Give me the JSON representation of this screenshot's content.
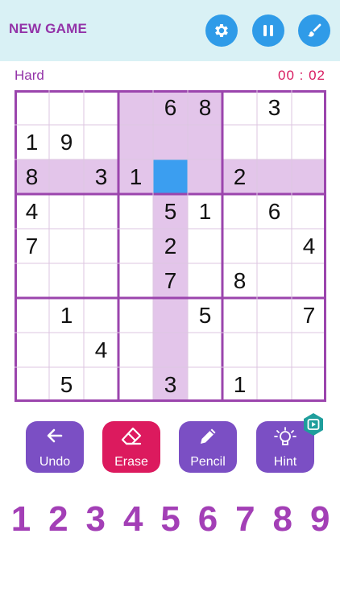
{
  "header": {
    "new_game_label": "NEW GAME",
    "buttons": [
      {
        "name": "settings",
        "icon": "gear-icon"
      },
      {
        "name": "pause",
        "icon": "pause-icon"
      },
      {
        "name": "theme",
        "icon": "paint-brush-icon"
      }
    ]
  },
  "status": {
    "difficulty": "Hard",
    "timer": "00 : 02"
  },
  "board": {
    "rows": [
      [
        "",
        "",
        "",
        "",
        "6",
        "8",
        "",
        "3",
        ""
      ],
      [
        "1",
        "9",
        "",
        "",
        "",
        "",
        "",
        "",
        ""
      ],
      [
        "8",
        "",
        "3",
        "1",
        "",
        "",
        "2",
        "",
        ""
      ],
      [
        "4",
        "",
        "",
        "",
        "5",
        "1",
        "",
        "6",
        ""
      ],
      [
        "7",
        "",
        "",
        "",
        "2",
        "",
        "",
        "",
        "4"
      ],
      [
        "",
        "",
        "",
        "",
        "7",
        "",
        "8",
        "",
        ""
      ],
      [
        "",
        "1",
        "",
        "",
        "",
        "5",
        "",
        "",
        "7"
      ],
      [
        "",
        "",
        "4",
        "",
        "",
        "",
        "",
        "",
        ""
      ],
      [
        "",
        "5",
        "",
        "",
        "3",
        "",
        "1",
        "",
        ""
      ]
    ],
    "selected": {
      "row": 2,
      "col": 4
    },
    "colors": {
      "highlight": "#e3c5ea",
      "selected": "#3b9ef0",
      "thin_line": "#dcc6e1",
      "thick_line": "#9b45ad"
    }
  },
  "actions": [
    {
      "name": "undo",
      "label": "Undo",
      "icon": "arrow-left-icon",
      "color": "#7b4fc4"
    },
    {
      "name": "erase",
      "label": "Erase",
      "icon": "eraser-icon",
      "color": "#dc1a5e"
    },
    {
      "name": "pencil",
      "label": "Pencil",
      "icon": "pencil-icon",
      "color": "#7b4fc4"
    },
    {
      "name": "hint",
      "label": "Hint",
      "icon": "lightbulb-icon",
      "color": "#7b4fc4"
    }
  ],
  "hint_badge": {
    "icon": "video-play-icon",
    "color": "#1f9e9c"
  },
  "numpad": [
    "1",
    "2",
    "3",
    "4",
    "5",
    "6",
    "7",
    "8",
    "9"
  ]
}
